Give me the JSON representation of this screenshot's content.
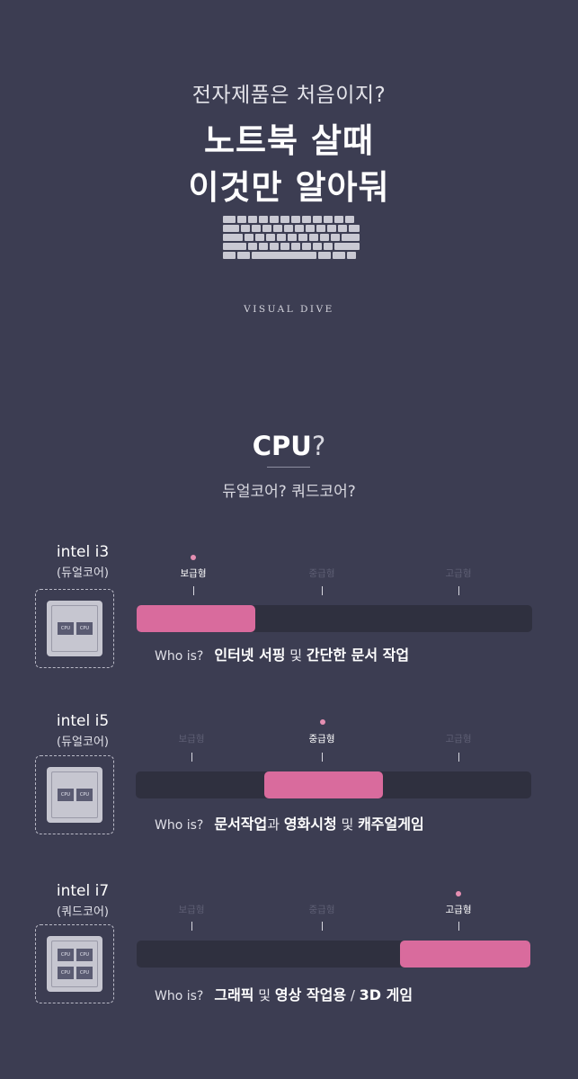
{
  "header": {
    "subtitle": "전자제품은 처음이지?",
    "title_line1": "노트북 살때",
    "title_line2": "이것만 알아둬",
    "brand": "VISUAL DIVE"
  },
  "section": {
    "title": "CPU",
    "title_mark": "?",
    "subtitle": "듀얼코어? 쿼드코어?"
  },
  "tiers": [
    "보급형",
    "중급형",
    "고급형"
  ],
  "core_label": "CPU",
  "colors": {
    "background": "#3c3d52",
    "bar_track": "#2f303f",
    "bar_fill": "#d96b9d",
    "marker_dot": "#e58fb2"
  },
  "cpus": [
    {
      "name": "intel i3",
      "core_type": "(듀얼코어)",
      "cores": 2,
      "active_tier": "보급형",
      "range": [
        0,
        0.3
      ],
      "whois": {
        "lead": "Who is?",
        "p1": "인터넷 서핑",
        "p2": " 및 ",
        "p3": "간단한 ",
        "p4": "문서 작업"
      }
    },
    {
      "name": "intel i5",
      "core_type": "(듀얼코어)",
      "cores": 2,
      "active_tier": "중급형",
      "range": [
        0.325,
        0.625
      ],
      "whois": {
        "lead": "Who is?",
        "p1": "문서작업",
        "p2": "과 ",
        "p3": "영화시청",
        "p4": " 및 ",
        "p5": "캐주얼게임"
      }
    },
    {
      "name": "intel i7",
      "core_type": "(쿼드코어)",
      "cores": 4,
      "active_tier": "고급형",
      "range": [
        0.67,
        1.0
      ],
      "whois": {
        "lead": "Who is?",
        "p1": "그래픽",
        "p2": " 및 ",
        "p3": "영상 작업용",
        "p4": " / ",
        "p5": "3D 게임"
      }
    }
  ]
}
